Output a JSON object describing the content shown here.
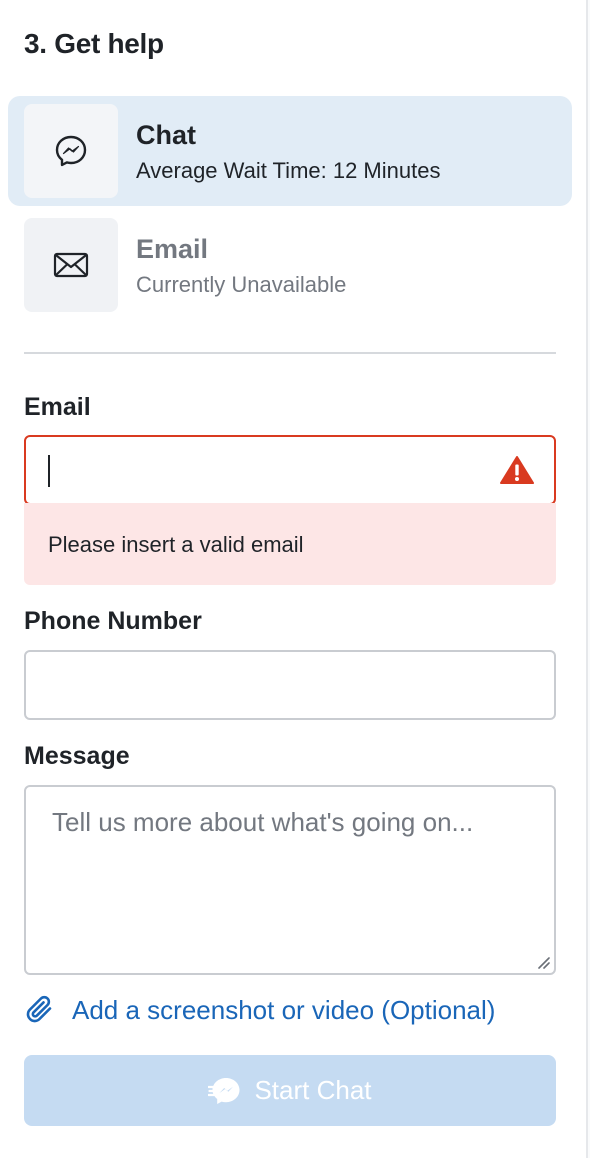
{
  "section": {
    "title": "3. Get help"
  },
  "options": [
    {
      "title": "Chat",
      "subtitle": "Average Wait Time: 12 Minutes",
      "icon": "messenger-icon",
      "selected": true
    },
    {
      "title": "Email",
      "subtitle": "Currently Unavailable",
      "icon": "envelope-icon",
      "selected": false
    }
  ],
  "form": {
    "email": {
      "label": "Email",
      "value": "",
      "error": "Please insert a valid email"
    },
    "phone": {
      "label": "Phone Number",
      "value": ""
    },
    "message": {
      "label": "Message",
      "placeholder": "Tell us more about what's going on..."
    },
    "attach_label": "Add a screenshot or video (Optional)",
    "submit_label": "Start Chat"
  },
  "colors": {
    "selected_bg": "#e1ecf6",
    "error": "#d93a20",
    "error_bg": "#fde6e6",
    "link": "#1a66b8",
    "button_disabled": "#c5dbf2"
  }
}
